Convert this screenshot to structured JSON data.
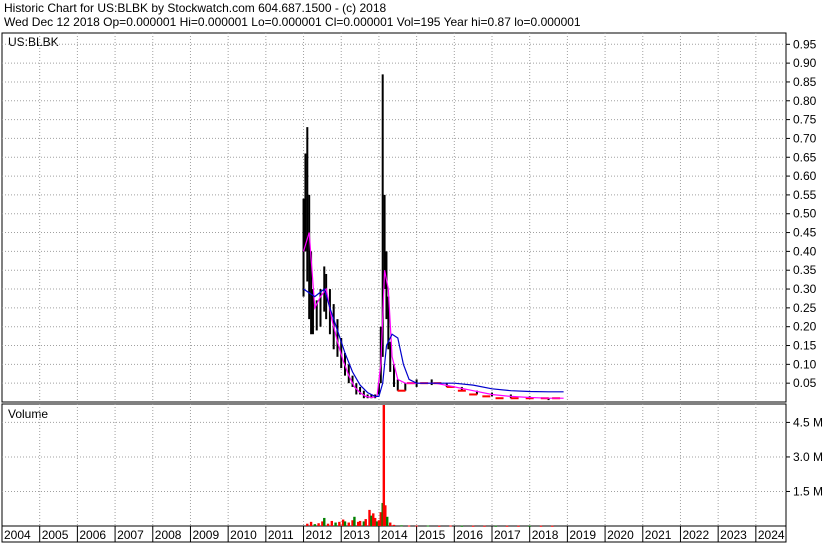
{
  "header": {
    "line1": "Historic Chart for US:BLBK by Stockwatch.com 604.687.1500 - (c) 2018",
    "line2": "Wed Dec 12 2018   Op=0.000001   Hi=0.000001   Lo=0.000001   Cl=0.000001   Vol=195   Year hi=0.87   lo=0.000001"
  },
  "colors": {
    "price_bars": "#000000",
    "volume_bars": "#ff0000",
    "ma_short": "#ff00ff",
    "ma_long": "#0000cc",
    "close_marks": "#ff0000",
    "grid": "#a0a0a0"
  },
  "chart_data": [
    {
      "type": "line",
      "panel": "price",
      "symbol_label": "US:BLBK",
      "ylim": [
        0,
        0.98
      ],
      "yticks": [
        "0.05",
        "0.10",
        "0.15",
        "0.20",
        "0.25",
        "0.30",
        "0.35",
        "0.40",
        "0.45",
        "0.50",
        "0.55",
        "0.60",
        "0.65",
        "0.70",
        "0.75",
        "0.80",
        "0.85",
        "0.90",
        "0.95"
      ],
      "xlim": [
        2004,
        2024.8
      ],
      "x_tick_labels": [
        "2004",
        "2005",
        "2006",
        "2007",
        "2008",
        "2009",
        "2010",
        "2011",
        "2012",
        "2013",
        "2014",
        "2015",
        "2016",
        "2017",
        "2018",
        "2019",
        "2020",
        "2021",
        "2022",
        "2023",
        "2024"
      ],
      "grid": true,
      "bars": [
        {
          "x": 2012.0,
          "low": 0.28,
          "high": 0.54
        },
        {
          "x": 2012.05,
          "low": 0.4,
          "high": 0.66
        },
        {
          "x": 2012.1,
          "low": 0.32,
          "high": 0.73
        },
        {
          "x": 2012.15,
          "low": 0.22,
          "high": 0.55
        },
        {
          "x": 2012.2,
          "low": 0.18,
          "high": 0.4
        },
        {
          "x": 2012.25,
          "low": 0.18,
          "high": 0.3
        },
        {
          "x": 2012.35,
          "low": 0.19,
          "high": 0.27
        },
        {
          "x": 2012.45,
          "low": 0.2,
          "high": 0.3
        },
        {
          "x": 2012.55,
          "low": 0.24,
          "high": 0.36
        },
        {
          "x": 2012.6,
          "low": 0.22,
          "high": 0.34
        },
        {
          "x": 2012.7,
          "low": 0.18,
          "high": 0.3
        },
        {
          "x": 2012.8,
          "low": 0.14,
          "high": 0.26
        },
        {
          "x": 2012.9,
          "low": 0.12,
          "high": 0.22
        },
        {
          "x": 2013.0,
          "low": 0.09,
          "high": 0.17
        },
        {
          "x": 2013.1,
          "low": 0.07,
          "high": 0.13
        },
        {
          "x": 2013.2,
          "low": 0.05,
          "high": 0.1
        },
        {
          "x": 2013.3,
          "low": 0.04,
          "high": 0.07
        },
        {
          "x": 2013.4,
          "low": 0.02,
          "high": 0.05
        },
        {
          "x": 2013.5,
          "low": 0.02,
          "high": 0.04
        },
        {
          "x": 2013.6,
          "low": 0.01,
          "high": 0.03
        },
        {
          "x": 2013.7,
          "low": 0.01,
          "high": 0.02
        },
        {
          "x": 2013.8,
          "low": 0.01,
          "high": 0.02
        },
        {
          "x": 2013.9,
          "low": 0.01,
          "high": 0.02
        },
        {
          "x": 2014.0,
          "low": 0.02,
          "high": 0.05
        },
        {
          "x": 2014.05,
          "low": 0.05,
          "high": 0.2
        },
        {
          "x": 2014.1,
          "low": 0.12,
          "high": 0.87
        },
        {
          "x": 2014.15,
          "low": 0.3,
          "high": 0.55
        },
        {
          "x": 2014.2,
          "low": 0.22,
          "high": 0.4
        },
        {
          "x": 2014.25,
          "low": 0.14,
          "high": 0.28
        },
        {
          "x": 2014.3,
          "low": 0.08,
          "high": 0.16
        },
        {
          "x": 2014.4,
          "low": 0.04,
          "high": 0.1
        },
        {
          "x": 2014.5,
          "low": 0.03,
          "high": 0.06
        },
        {
          "x": 2014.7,
          "low": 0.03,
          "high": 0.05
        },
        {
          "x": 2015.0,
          "low": 0.04,
          "high": 0.06
        },
        {
          "x": 2015.4,
          "low": 0.045,
          "high": 0.06
        },
        {
          "x": 2015.8,
          "low": 0.04,
          "high": 0.05
        },
        {
          "x": 2016.2,
          "low": 0.03,
          "high": 0.04
        },
        {
          "x": 2016.6,
          "low": 0.02,
          "high": 0.03
        },
        {
          "x": 2017.0,
          "low": 0.015,
          "high": 0.025
        },
        {
          "x": 2017.5,
          "low": 0.01,
          "high": 0.02
        },
        {
          "x": 2018.0,
          "low": 0.01,
          "high": 0.015
        },
        {
          "x": 2018.5,
          "low": 0.005,
          "high": 0.01
        }
      ],
      "close_marks": [
        {
          "x": 2014.6,
          "y": 0.03
        },
        {
          "x": 2014.85,
          "y": 0.05
        },
        {
          "x": 2015.2,
          "y": 0.05
        },
        {
          "x": 2015.55,
          "y": 0.05
        },
        {
          "x": 2015.9,
          "y": 0.04
        },
        {
          "x": 2016.2,
          "y": 0.03
        },
        {
          "x": 2016.5,
          "y": 0.02
        },
        {
          "x": 2016.85,
          "y": 0.015
        },
        {
          "x": 2017.2,
          "y": 0.01
        },
        {
          "x": 2017.6,
          "y": 0.01
        },
        {
          "x": 2018.0,
          "y": 0.01
        },
        {
          "x": 2018.4,
          "y": 0.01
        },
        {
          "x": 2018.7,
          "y": 0.01
        }
      ],
      "series": [
        {
          "color": "#ff00ff",
          "x": [
            2012.0,
            2012.15,
            2012.3,
            2012.45,
            2012.6,
            2012.75,
            2012.9,
            2013.05,
            2013.2,
            2013.35,
            2013.5,
            2013.65,
            2013.8,
            2013.95,
            2014.05,
            2014.15,
            2014.25,
            2014.35,
            2014.5,
            2014.7,
            2015.0,
            2015.5,
            2016.0,
            2016.5,
            2017.0,
            2017.5,
            2018.0,
            2018.5,
            2018.9
          ],
          "y": [
            0.4,
            0.45,
            0.25,
            0.28,
            0.3,
            0.22,
            0.16,
            0.11,
            0.07,
            0.04,
            0.025,
            0.015,
            0.012,
            0.015,
            0.1,
            0.35,
            0.3,
            0.12,
            0.06,
            0.05,
            0.05,
            0.05,
            0.04,
            0.03,
            0.02,
            0.015,
            0.012,
            0.01,
            0.01
          ]
        },
        {
          "color": "#0000cc",
          "x": [
            2012.0,
            2012.3,
            2012.55,
            2012.7,
            2012.9,
            2013.1,
            2013.3,
            2013.5,
            2013.7,
            2013.9,
            2014.0,
            2014.1,
            2014.2,
            2014.35,
            2014.5,
            2014.65,
            2014.8,
            2015.0,
            2015.5,
            2016.0,
            2016.5,
            2017.0,
            2017.5,
            2018.0,
            2018.5,
            2018.9
          ],
          "y": [
            0.3,
            0.28,
            0.3,
            0.25,
            0.19,
            0.13,
            0.08,
            0.045,
            0.025,
            0.015,
            0.015,
            0.05,
            0.15,
            0.18,
            0.17,
            0.1,
            0.06,
            0.05,
            0.05,
            0.05,
            0.045,
            0.035,
            0.03,
            0.028,
            0.027,
            0.027
          ]
        }
      ]
    },
    {
      "type": "bar",
      "panel": "volume",
      "title": "Volume",
      "ylim": [
        0,
        5.3
      ],
      "yticks": [
        "1.5 M",
        "3.0 M",
        "4.5 M"
      ],
      "unit": "M",
      "colors": [
        "#ff0000",
        "#008000"
      ],
      "bars": [
        {
          "x": 2012.1,
          "v": 0.1
        },
        {
          "x": 2012.2,
          "v": 0.18
        },
        {
          "x": 2012.3,
          "v": 0.08
        },
        {
          "x": 2012.4,
          "v": 0.12
        },
        {
          "x": 2012.5,
          "v": 0.2
        },
        {
          "x": 2012.55,
          "v": 0.35
        },
        {
          "x": 2012.65,
          "v": 0.1
        },
        {
          "x": 2012.75,
          "v": 0.22
        },
        {
          "x": 2012.85,
          "v": 0.15
        },
        {
          "x": 2012.95,
          "v": 0.18
        },
        {
          "x": 2013.05,
          "v": 0.28
        },
        {
          "x": 2013.1,
          "v": 0.2
        },
        {
          "x": 2013.2,
          "v": 0.15
        },
        {
          "x": 2013.3,
          "v": 0.25
        },
        {
          "x": 2013.35,
          "v": 0.4
        },
        {
          "x": 2013.45,
          "v": 0.18
        },
        {
          "x": 2013.5,
          "v": 0.22
        },
        {
          "x": 2013.6,
          "v": 0.2
        },
        {
          "x": 2013.65,
          "v": 0.3
        },
        {
          "x": 2013.75,
          "v": 0.7
        },
        {
          "x": 2013.8,
          "v": 0.45
        },
        {
          "x": 2013.85,
          "v": 0.55
        },
        {
          "x": 2013.9,
          "v": 0.35
        },
        {
          "x": 2013.95,
          "v": 0.2
        },
        {
          "x": 2014.0,
          "v": 0.25
        },
        {
          "x": 2014.05,
          "v": 0.6
        },
        {
          "x": 2014.1,
          "v": 1.0
        },
        {
          "x": 2014.13,
          "v": 5.4
        },
        {
          "x": 2014.17,
          "v": 0.9
        },
        {
          "x": 2014.22,
          "v": 0.4
        },
        {
          "x": 2014.3,
          "v": 0.15
        },
        {
          "x": 2014.4,
          "v": 0.05
        },
        {
          "x": 2014.6,
          "v": 0.03
        },
        {
          "x": 2014.8,
          "v": 0.02
        },
        {
          "x": 2015.0,
          "v": 0.02
        },
        {
          "x": 2015.3,
          "v": 0.02
        },
        {
          "x": 2015.6,
          "v": 0.01
        },
        {
          "x": 2015.9,
          "v": 0.02
        },
        {
          "x": 2016.2,
          "v": 0.01
        },
        {
          "x": 2016.5,
          "v": 0.01
        },
        {
          "x": 2016.8,
          "v": 0.01
        },
        {
          "x": 2017.1,
          "v": 0.01
        },
        {
          "x": 2017.4,
          "v": 0.01
        },
        {
          "x": 2017.7,
          "v": 0.01
        },
        {
          "x": 2018.0,
          "v": 0.01
        },
        {
          "x": 2018.3,
          "v": 0.01
        },
        {
          "x": 2018.6,
          "v": 0.01
        }
      ]
    }
  ]
}
